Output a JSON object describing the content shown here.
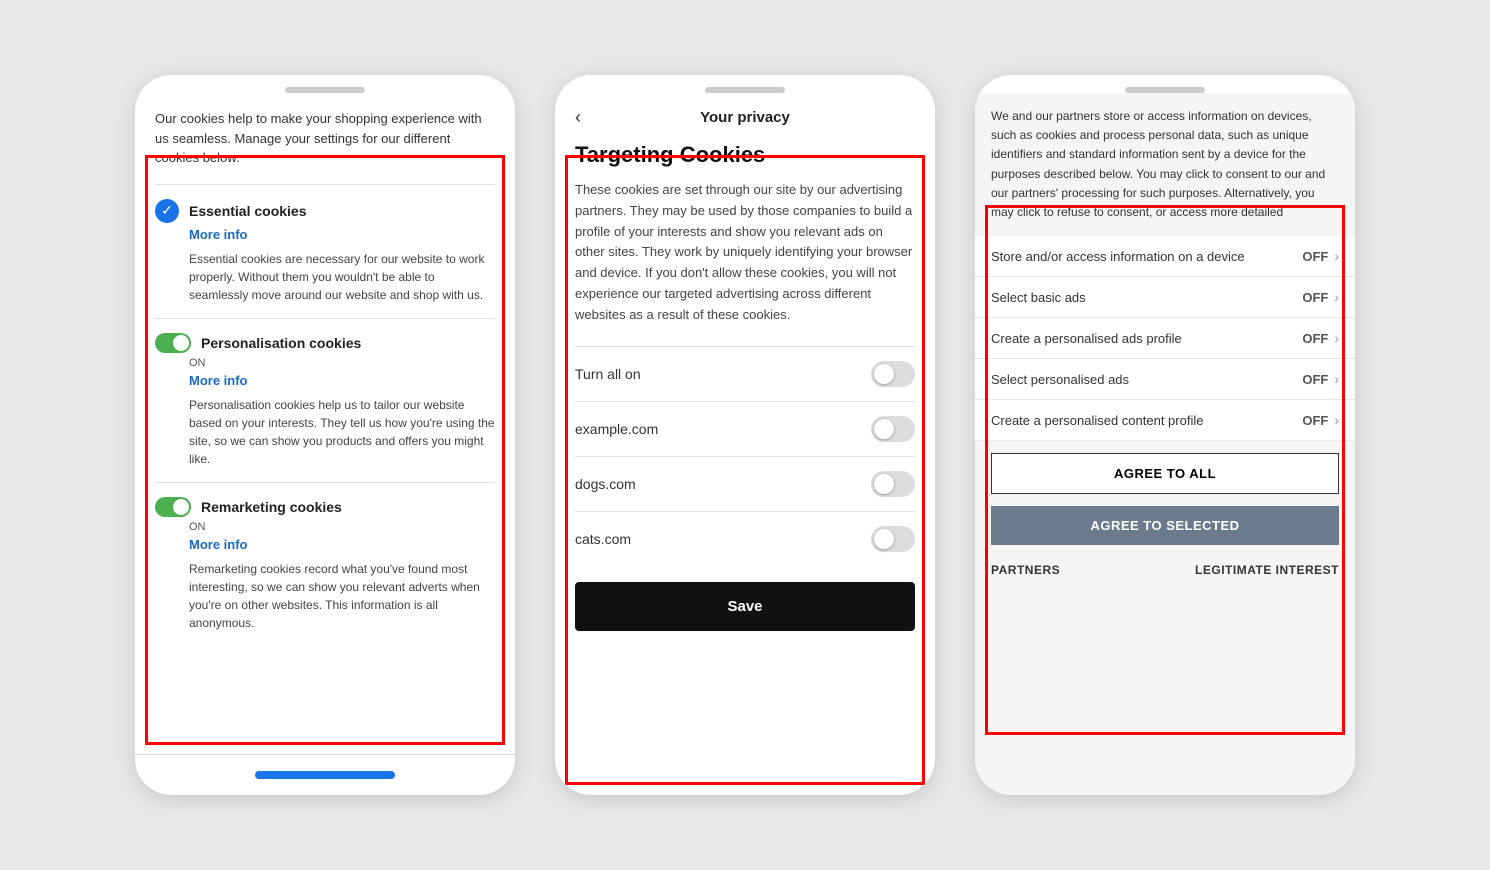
{
  "phone1": {
    "intro": "Our cookies help to make your shopping experience with us seamless. Manage your settings for our different cookies below.",
    "sections": [
      {
        "id": "essential",
        "title": "Essential cookies",
        "type": "check",
        "more_info": "More info",
        "description": "Essential cookies are necessary for our website to work properly. Without them you wouldn't be able to seamlessly move around our website and shop with us."
      },
      {
        "id": "personalisation",
        "title": "Personalisation cookies",
        "type": "toggle",
        "on_label": "ON",
        "more_info": "More info",
        "description": "Personalisation cookies help us to tailor our website based on your interests. They tell us how you're using the site, so we can show you products and offers you might like."
      },
      {
        "id": "remarketing",
        "title": "Remarketing cookies",
        "type": "toggle",
        "on_label": "ON",
        "more_info": "More info",
        "description": "Remarketing cookies record what you've found most interesting, so we can show you relevant adverts when you're on other websites. This information is all anonymous."
      }
    ]
  },
  "phone2": {
    "back_label": "‹",
    "header_title": "Your privacy",
    "targeting_title": "Targeting Cookies",
    "description": "These cookies are set through our site by our advertising partners. They may be used by those companies to build a profile of your interests and show you relevant ads on other sites. They work by uniquely identifying your browser and device. If you don't allow these cookies, you will not experience our targeted advertising across different websites as a result of these cookies.",
    "toggle_rows": [
      {
        "label": "Turn all on"
      },
      {
        "label": "example.com"
      },
      {
        "label": "dogs.com"
      },
      {
        "label": "cats.com"
      }
    ],
    "save_label": "Save"
  },
  "phone3": {
    "privacy_desc": "We and our partners store or access information on devices, such as cookies and process personal data, such as unique identifiers and standard information sent by a device for the purposes described below. You may click to consent to our and our partners' processing for such purposes. Alternatively, you may click to refuse to consent, or access more detailed",
    "consent_rows": [
      {
        "label": "Store and/or access information on a device",
        "status": "OFF"
      },
      {
        "label": "Select basic ads",
        "status": "OFF"
      },
      {
        "label": "Create a personalised ads profile",
        "status": "OFF"
      },
      {
        "label": "Select personalised ads",
        "status": "OFF"
      },
      {
        "label": "Create a personalised content profile",
        "status": "OFF"
      }
    ],
    "agree_all_label": "AGREE TO ALL",
    "agree_selected_label": "AGREE TO SELECTED",
    "footer_left": "PARTNERS",
    "footer_right": "LEGITIMATE INTEREST"
  }
}
